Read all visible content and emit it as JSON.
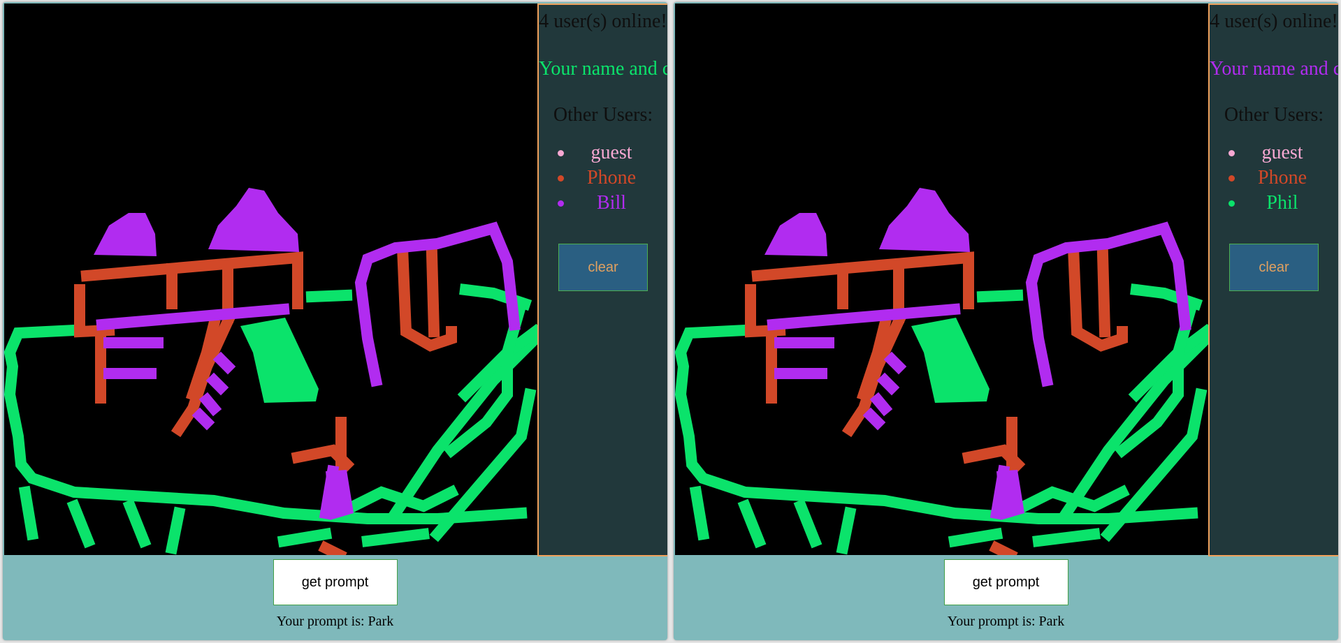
{
  "colors": {
    "canvas": "#000000",
    "sidebar_bg": "#21383b",
    "sidebar_border": "#efa15c",
    "panel_bg": "#7fb9bb",
    "phil": "#0be36b",
    "bill": "#b12cf0",
    "phone": "#d24828",
    "guest": "#f7a8d2"
  },
  "windows": [
    {
      "online_count": "4 user(s) online!",
      "your_name_label": "Your name and color: Phil",
      "your_color": "#0be36b",
      "other_users_heading": "Other Users:",
      "other_users": [
        {
          "name": "guest",
          "color": "#f7a8d2"
        },
        {
          "name": "Phone",
          "color": "#d24828"
        },
        {
          "name": "Bill",
          "color": "#b12cf0"
        }
      ],
      "clear_label": "clear",
      "get_prompt_label": "get prompt",
      "prompt_text": "Your prompt is: Park"
    },
    {
      "online_count": "4 user(s) online!",
      "your_name_label": "Your name and color: Bill",
      "your_color": "#b12cf0",
      "other_users_heading": "Other Users:",
      "other_users": [
        {
          "name": "guest",
          "color": "#f7a8d2"
        },
        {
          "name": "Phone",
          "color": "#d24828"
        },
        {
          "name": "Phil",
          "color": "#0be36b"
        }
      ],
      "clear_label": "clear",
      "get_prompt_label": "get prompt",
      "prompt_text": "Your prompt is: Park"
    }
  ]
}
